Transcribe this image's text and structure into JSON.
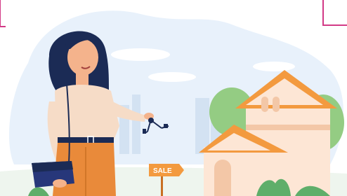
{
  "illustration": {
    "sign_text": "SALE",
    "colors": {
      "sky_blob": "#e8f1fb",
      "cloud": "#ffffff",
      "city": "#d3e2f2",
      "hair": "#1b2b55",
      "skin": "#f4b38c",
      "top": "#f6dcc7",
      "pants": "#e98a3a",
      "bag": "#27377a",
      "roof": "#f39a3f",
      "house_wall": "#fde6d5",
      "house_wall_shadow": "#f3c7a7",
      "tree": "#94cc83",
      "grass": "#5fae6a",
      "sign": "#f39a3f",
      "accent_frame": "#d23a86"
    },
    "icons": [
      "keys-icon",
      "handbag-icon",
      "sale-sign-icon"
    ]
  }
}
